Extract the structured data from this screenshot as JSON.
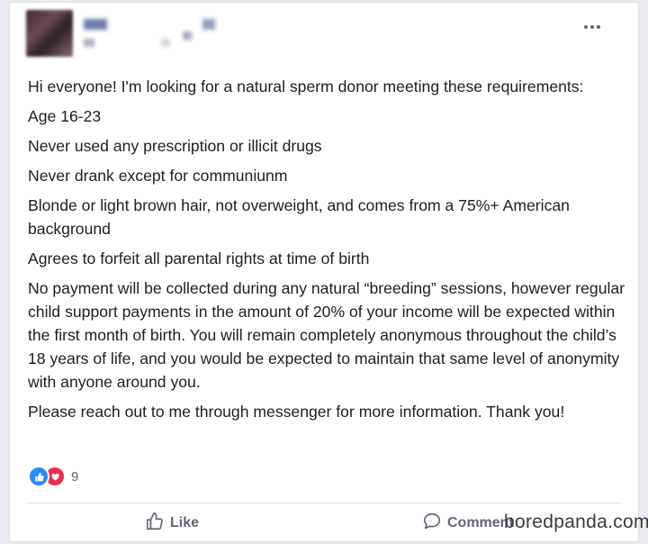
{
  "post": {
    "paragraphs": [
      "Hi everyone! I'm looking for a natural sperm donor meeting these requirements:",
      "Age 16-23",
      "Never used any prescription or illicit drugs",
      "Never drank except for communiunm",
      "Blonde or light brown hair, not overweight, and comes from a 75%+ American background",
      "Agrees to forfeit all parental rights at time of birth",
      "No payment will be collected during any natural “breeding” sessions, however regular child support payments in the amount of 20% of your income will be expected within the first month of birth. You will remain completely anonymous throughout the child’s 18 years of life, and you would be expected to maintain that same level of anonymity with anyone around you.",
      "Please reach out to me through messenger for more information. Thank you!"
    ]
  },
  "reactions": {
    "count": "9"
  },
  "actions": {
    "like_label": "Like",
    "comment_label": "Comment"
  },
  "watermark": {
    "text": "boredpanda.com"
  },
  "colors": {
    "like_blue": "#2d88ff",
    "love_red": "#e8304a",
    "action_gray": "#606770"
  }
}
